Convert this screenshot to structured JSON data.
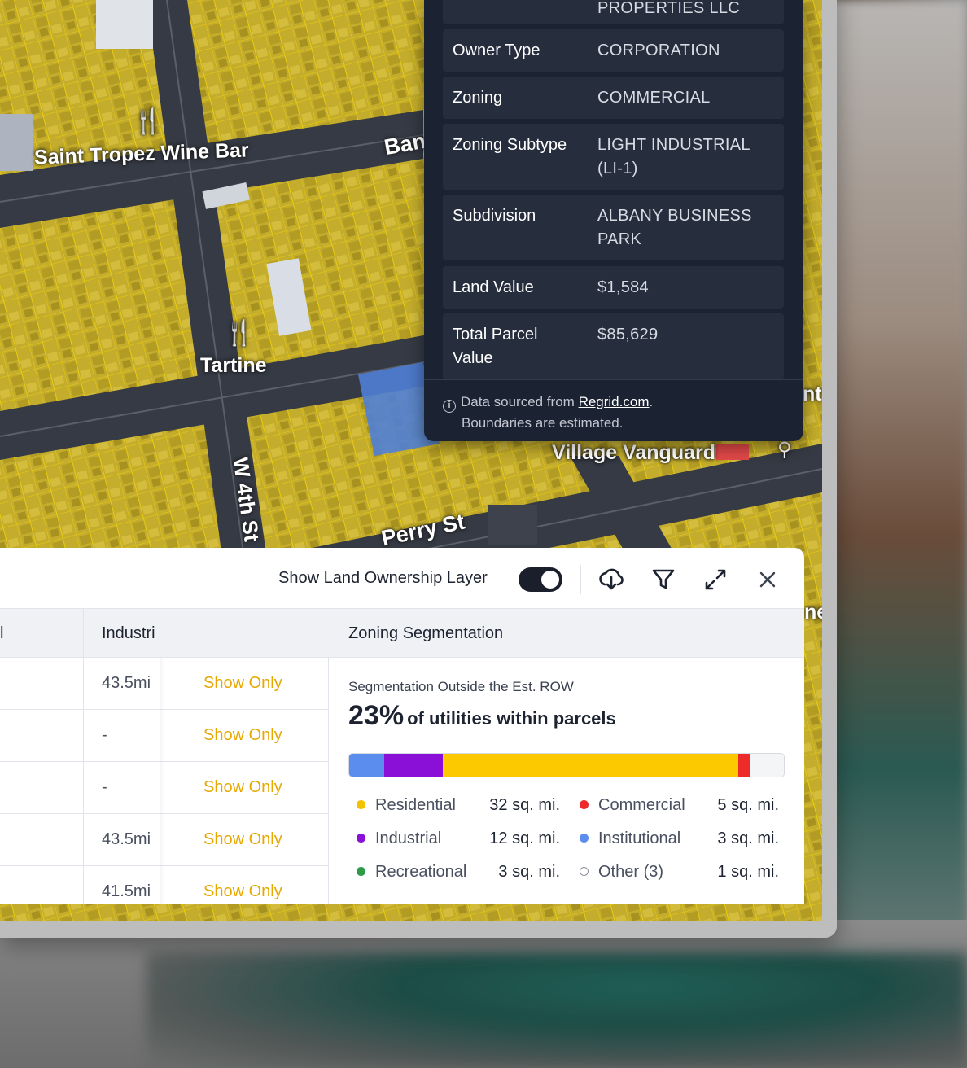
{
  "map": {
    "labels": {
      "wine_bar": "Saint Tropez Wine Bar",
      "bank_partial": "Ban",
      "tartine": "Tartine",
      "w4th": "W 4th St",
      "village_vanguard": "Village Vanguard",
      "perry": "Perry St",
      "edge_nt": "nt",
      "edge_ne": "ne"
    },
    "colors": {
      "parcel": "#c9b12a",
      "parcel_line": "#e6c800",
      "road": "#353a44",
      "selected_parcel": "#4f7fd6"
    }
  },
  "popup": {
    "top_partial_value": "PROPERTIES LLC",
    "rows": [
      {
        "key": "Owner Type",
        "value": "CORPORATION"
      },
      {
        "key": "Zoning",
        "value": "COMMERCIAL"
      },
      {
        "key": "Zoning Subtype",
        "value": "LIGHT INDUSTRIAL (LI-1)"
      },
      {
        "key": "Subdivision",
        "value": "ALBANY BUSINESS PARK"
      },
      {
        "key": "Land Value",
        "value": "$1,584"
      },
      {
        "key": "Total Parcel Value",
        "value": "$85,629"
      }
    ],
    "footer": {
      "prefix": "Data sourced from ",
      "link": "Regrid.com",
      "suffix": ".",
      "line2": "Boundaries are estimated."
    }
  },
  "panel": {
    "toggle_label": "Show Land Ownership Layer",
    "toggle_on": true,
    "table": {
      "col_partial": "l",
      "col_industrial": "Industri",
      "rows": [
        {
          "miles": "43.5mi",
          "action": "Show Only"
        },
        {
          "miles": "-",
          "action": "Show Only"
        },
        {
          "miles": "-",
          "action": "Show Only"
        },
        {
          "miles": "43.5mi",
          "action": "Show Only"
        },
        {
          "miles": "41.5mi",
          "action": "Show Only"
        }
      ]
    },
    "segmentation": {
      "title": "Zoning Segmentation",
      "subtitle": "Segmentation Outside the Est. ROW",
      "percent": "23%",
      "percent_text": "of utilities within parcels",
      "bar": [
        {
          "name": "Institutional",
          "fraction": 0.08,
          "color": "#5b8def"
        },
        {
          "name": "Industrial",
          "fraction": 0.135,
          "color": "#8a10d8"
        },
        {
          "name": "Residential",
          "fraction": 0.68,
          "color": "#fcc800"
        },
        {
          "name": "Commercial",
          "fraction": 0.027,
          "color": "#ee2b2b"
        },
        {
          "name": "Other",
          "fraction": 0.078,
          "color": "#f4f5f7"
        }
      ],
      "legend": [
        {
          "label": "Residential",
          "value": "32 sq. mi.",
          "color": "#f2c200",
          "hollow": false
        },
        {
          "label": "Commercial",
          "value": "5 sq. mi.",
          "color": "#ee2b2b",
          "hollow": false
        },
        {
          "label": "Industrial",
          "value": "12 sq. mi.",
          "color": "#8a10d8",
          "hollow": false
        },
        {
          "label": "Institutional",
          "value": "3 sq. mi.",
          "color": "#5b8def",
          "hollow": false
        },
        {
          "label": "Recreational",
          "value": "3 sq. mi.",
          "color": "#2e9b48",
          "hollow": false
        },
        {
          "label": "Other (3)",
          "value": "1 sq. mi.",
          "color": "#8c909a",
          "hollow": true
        }
      ]
    }
  }
}
